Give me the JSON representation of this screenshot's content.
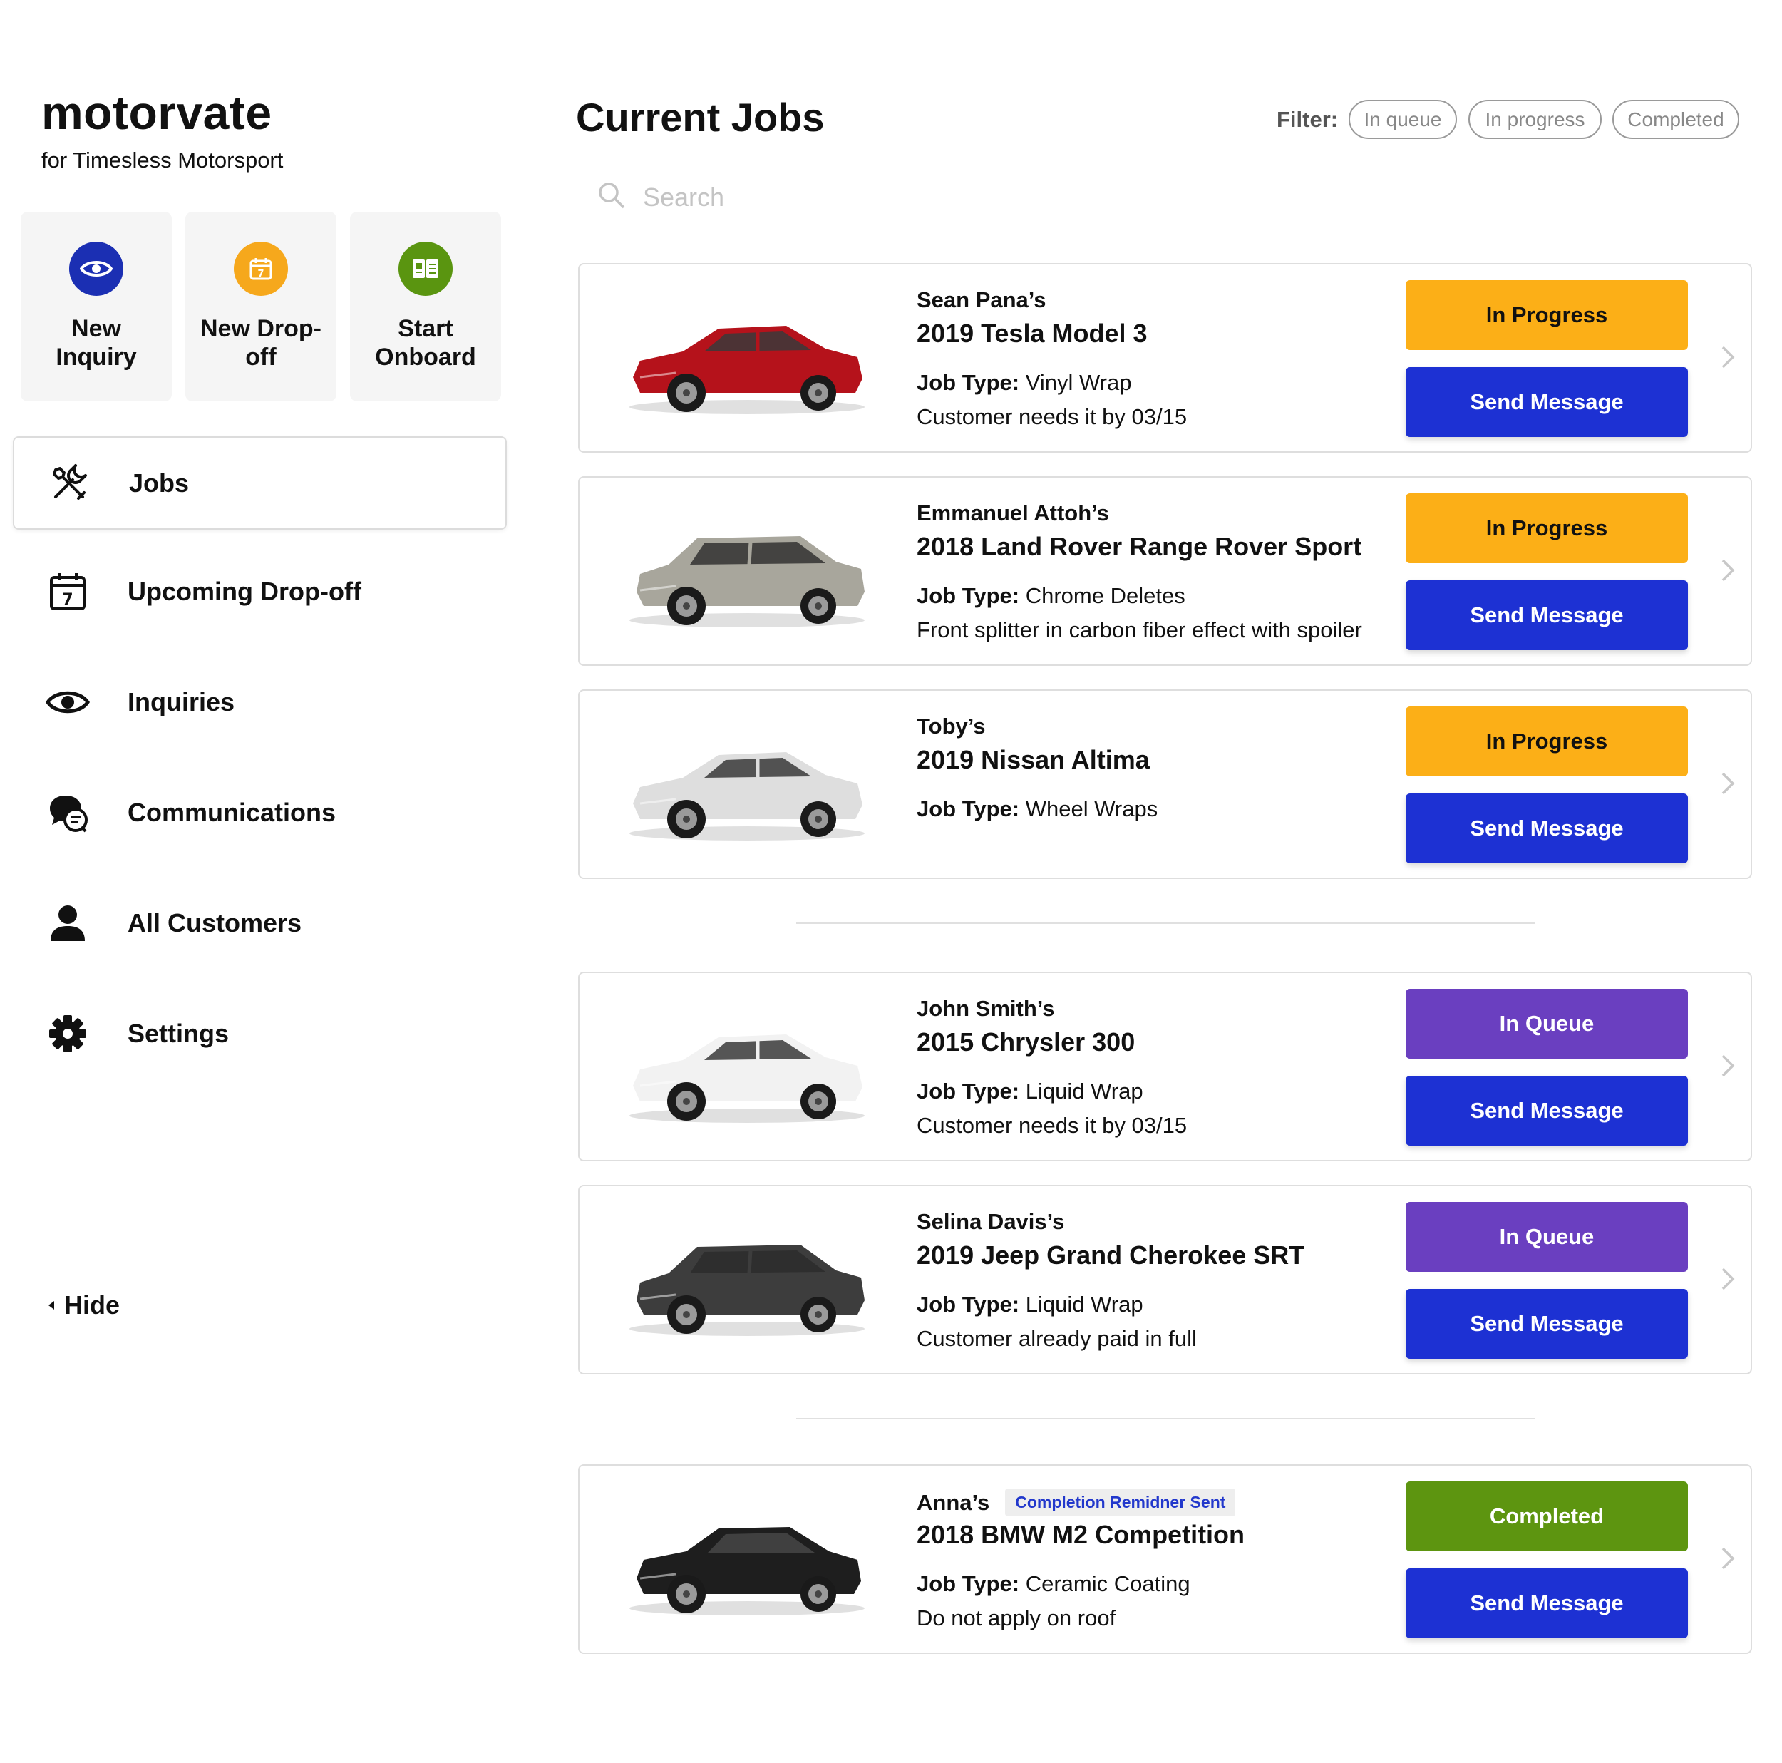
{
  "brand": {
    "name": "motorvate",
    "subtitle": "for Timesless Motorsport"
  },
  "quick_actions": [
    {
      "label": "New Inquiry",
      "icon": "eye-icon",
      "color": "#1b2fb3"
    },
    {
      "label": "New Drop-off",
      "icon": "calendar-icon",
      "color": "#f6a81c"
    },
    {
      "label": "Start Onboard",
      "icon": "onboard-book-icon",
      "color": "#5a9510"
    }
  ],
  "nav": {
    "items": [
      {
        "label": "Jobs",
        "icon": "wrench-screwdriver-icon",
        "active": true
      },
      {
        "label": "Upcoming Drop-off",
        "icon": "calendar-icon",
        "active": false
      },
      {
        "label": "Inquiries",
        "icon": "eye-icon",
        "active": false
      },
      {
        "label": "Communications",
        "icon": "chat-bubbles-icon",
        "active": false
      },
      {
        "label": "All Customers",
        "icon": "person-icon",
        "active": false
      },
      {
        "label": "Settings",
        "icon": "gear-icon",
        "active": false
      }
    ],
    "hide_label": "Hide"
  },
  "main": {
    "title": "Current Jobs",
    "filter": {
      "label": "Filter:",
      "options": [
        "In queue",
        "In progress",
        "Completed"
      ]
    },
    "search": {
      "placeholder": "Search",
      "value": ""
    }
  },
  "colors": {
    "in_progress": "#fcaf17",
    "in_queue": "#6a3fc0",
    "completed": "#5d9510",
    "send_message": "#1d31d3",
    "badge_text": "#2238cc"
  },
  "jobs": [
    {
      "owner": "Sean Pana’s",
      "vehicle": "2019 Tesla Model 3",
      "job_type_label": "Job Type:",
      "job_type": "Vinyl Wrap",
      "note": "Customer needs it by 03/15",
      "status": "In Progress",
      "action": "Send Message",
      "car_color": "#b5121b",
      "car_style": "sedan"
    },
    {
      "owner": "Emmanuel Attoh’s",
      "vehicle": "2018 Land Rover Range Rover Sport",
      "job_type_label": "Job Type:",
      "job_type": "Chrome Deletes",
      "note": "Front splitter in carbon fiber effect with spoiler",
      "status": "In Progress",
      "action": "Send Message",
      "car_color": "#a8a69c",
      "car_style": "suv"
    },
    {
      "owner": "Toby’s",
      "vehicle": "2019 Nissan Altima",
      "job_type_label": "Job Type:",
      "job_type": "Wheel Wraps",
      "note": "",
      "status": "In Progress",
      "action": "Send Message",
      "car_color": "#dedede",
      "car_style": "sedan"
    },
    {
      "owner": "John Smith’s",
      "vehicle": "2015 Chrysler 300",
      "job_type_label": "Job Type:",
      "job_type": "Liquid Wrap",
      "note": "Customer needs it by 03/15",
      "status": "In Queue",
      "action": "Send Message",
      "car_color": "#f2f2f2",
      "car_style": "sedan"
    },
    {
      "owner": "Selina Davis’s",
      "vehicle": "2019 Jeep Grand Cherokee SRT",
      "job_type_label": "Job Type:",
      "job_type": "Liquid Wrap",
      "note": "Customer already paid in full",
      "status": "In Queue",
      "action": "Send Message",
      "car_color": "#3d3d3d",
      "car_style": "suv"
    },
    {
      "owner": "Anna’s",
      "badge": "Completion Remidner Sent",
      "vehicle": "2018 BMW M2 Competition",
      "job_type_label": "Job Type:",
      "job_type": "Ceramic Coating",
      "note": "Do not apply on roof",
      "status": "Completed",
      "action": "Send Message",
      "car_color": "#1e1e1e",
      "car_style": "coupe"
    }
  ]
}
